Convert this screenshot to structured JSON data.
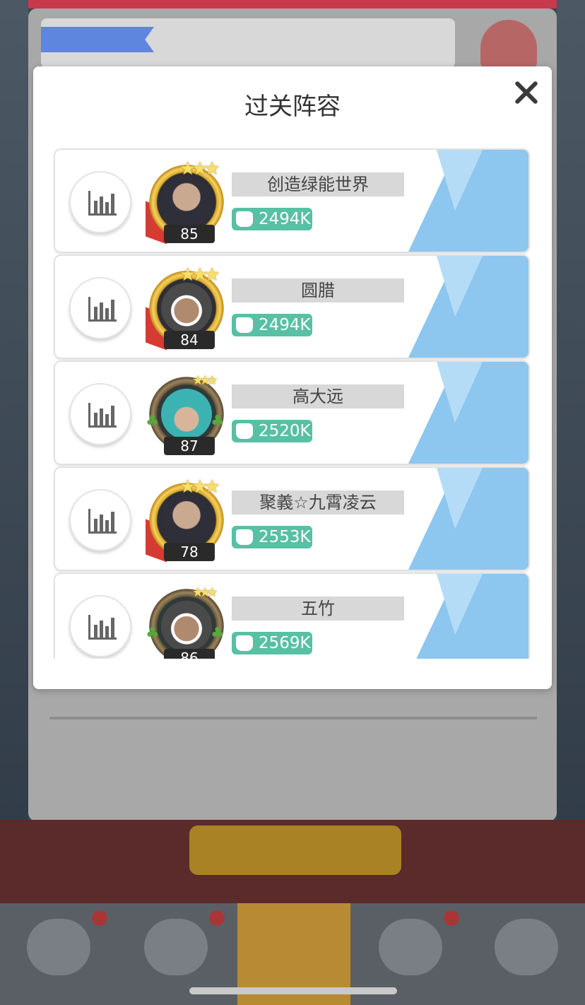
{
  "dialog": {
    "title": "过关阵容",
    "close_icon": "close-icon"
  },
  "entries": [
    {
      "name": "创造绿能世界",
      "level": "85",
      "power": "2494K",
      "frame": "gold"
    },
    {
      "name": "圆腊",
      "level": "84",
      "power": "2494K",
      "frame": "gold"
    },
    {
      "name": "高大远",
      "level": "87",
      "power": "2520K",
      "frame": "green"
    },
    {
      "name": "聚義☆九霄凌云",
      "level": "78",
      "power": "2553K",
      "frame": "gold"
    },
    {
      "name": "五竹",
      "level": "86",
      "power": "2569K",
      "frame": "green"
    }
  ],
  "colors": {
    "power_badge": "#58c0a4",
    "row_accent": "#8dc6ef",
    "name_bar": "#d8d8d8"
  }
}
